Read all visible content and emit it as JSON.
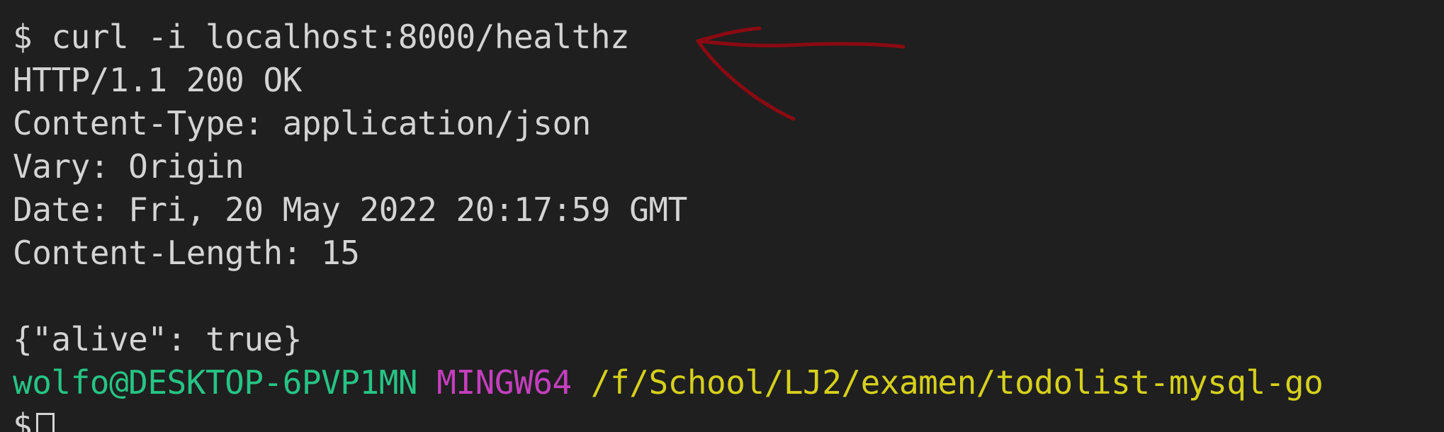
{
  "terminal": {
    "command_line": "$ curl -i localhost:8000/healthz",
    "response": [
      "HTTP/1.1 200 OK",
      "Content-Type: application/json",
      "Vary: Origin",
      "Date: Fri, 20 May 2022 20:17:59 GMT",
      "Content-Length: 15"
    ],
    "body": "{\"alive\": true}",
    "prompt": {
      "user_host": "wolfo@DESKTOP-6PVP1MN",
      "system": "MINGW64",
      "path": "/f/School/LJ2/examen/todolist-mysql-go",
      "symbol": "$"
    }
  },
  "colors": {
    "background": "#1f1f1f",
    "text": "#d4d4d4",
    "user_host": "#26c485",
    "system": "#c53fbe",
    "path": "#d6d01c",
    "annotation_arrow": "#8b0a12"
  },
  "annotation": {
    "icon": "hand-drawn-arrow-icon"
  }
}
